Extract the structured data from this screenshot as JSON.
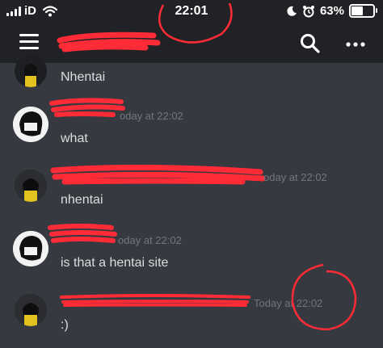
{
  "status_bar": {
    "carrier": "iD",
    "time": "22:01",
    "battery_level": "63%",
    "battery_fraction": 0.63
  },
  "header": {
    "channel_name": ""
  },
  "messages": [
    {
      "author": "",
      "timestamp": "",
      "text": "Nhentai",
      "avatar": "dark-haired-yellow-shirt"
    },
    {
      "author": "",
      "timestamp": "oday at 22:02",
      "text": "what",
      "avatar": "black-hair-white-bg"
    },
    {
      "author": "",
      "timestamp": "oday at 22:02",
      "text": "nhentai",
      "avatar": "dark-haired-yellow-shirt"
    },
    {
      "author": "",
      "timestamp": "oday at 22:02",
      "text": "is that a hentai site",
      "avatar": "black-hair-white-bg"
    },
    {
      "author": "",
      "timestamp": "Today at 22:02",
      "text": ":)",
      "avatar": "dark-haired-yellow-shirt"
    }
  ],
  "icons": {
    "menu": "hamburger-icon",
    "search": "search-icon",
    "more": "more-options-icon",
    "moon": "moon-icon",
    "alarm": "alarm-icon",
    "wifi": "wifi-icon"
  },
  "colors": {
    "background": "#36393f",
    "header": "#202225",
    "redaction": "#ff2b36",
    "timestamp": "#72767d"
  }
}
